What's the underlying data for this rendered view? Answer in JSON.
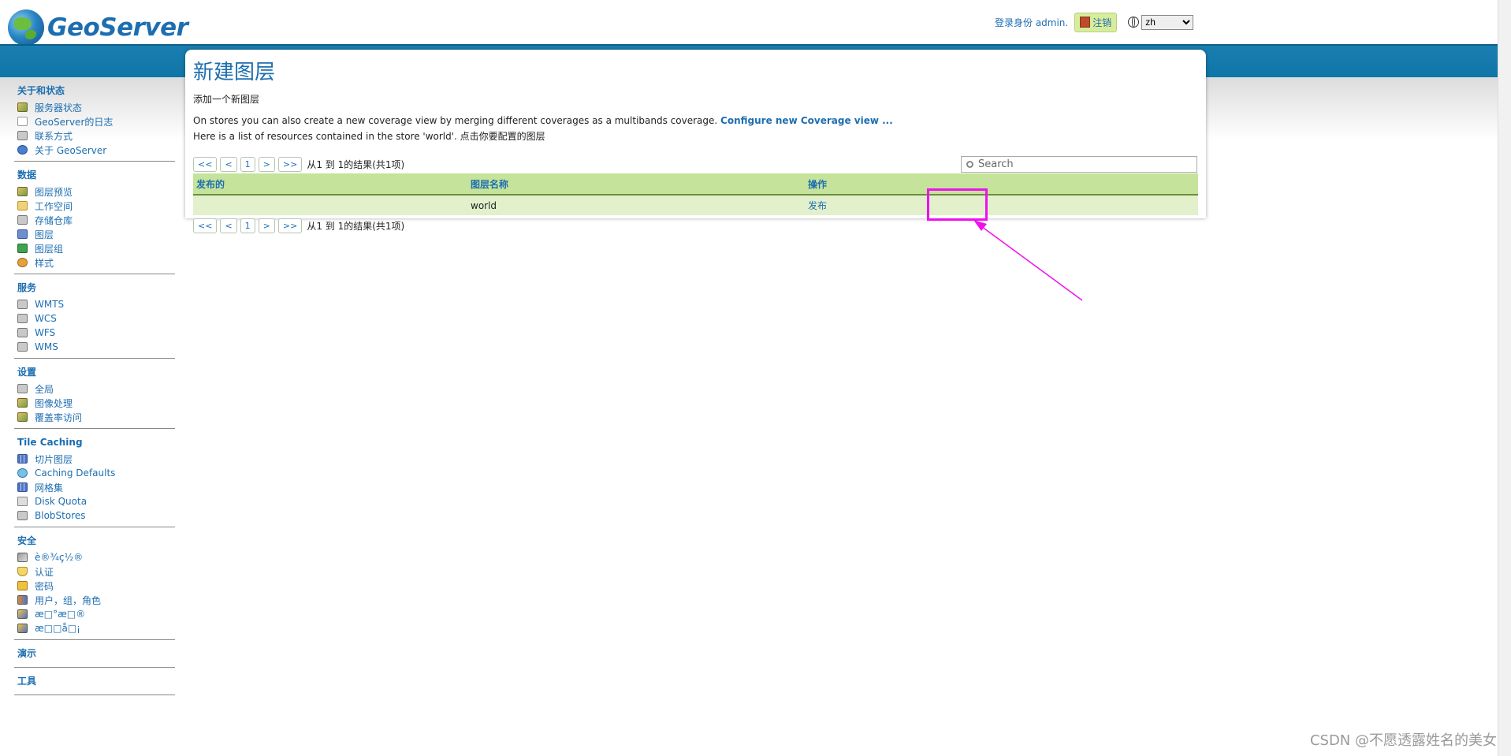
{
  "header": {
    "logo_text": "GeoServer",
    "login_status": "登录身份 admin.",
    "logout_label": "注销",
    "language_options": [
      "zh"
    ],
    "language_selected": "zh"
  },
  "sidebar": {
    "sections": [
      {
        "title": "关于和状态",
        "items": [
          {
            "label": "服务器状态",
            "icon": "server-status-icon"
          },
          {
            "label": "GeoServer的日志",
            "icon": "log-icon"
          },
          {
            "label": "联系方式",
            "icon": "contact-icon"
          },
          {
            "label": "关于 GeoServer",
            "icon": "info-icon"
          }
        ]
      },
      {
        "title": "数据",
        "items": [
          {
            "label": "图层预览",
            "icon": "layer-preview-icon"
          },
          {
            "label": "工作空间",
            "icon": "folder-icon"
          },
          {
            "label": "存储仓库",
            "icon": "store-icon"
          },
          {
            "label": "图层",
            "icon": "layer-icon"
          },
          {
            "label": "图层组",
            "icon": "layer-group-icon"
          },
          {
            "label": "样式",
            "icon": "style-palette-icon"
          }
        ]
      },
      {
        "title": "服务",
        "items": [
          {
            "label": "WMTS",
            "icon": "service-icon"
          },
          {
            "label": "WCS",
            "icon": "service-icon"
          },
          {
            "label": "WFS",
            "icon": "service-icon"
          },
          {
            "label": "WMS",
            "icon": "service-icon"
          }
        ]
      },
      {
        "title": "设置",
        "items": [
          {
            "label": "全局",
            "icon": "server-icon"
          },
          {
            "label": "图像处理",
            "icon": "image-icon"
          },
          {
            "label": "覆盖率访问",
            "icon": "image-icon"
          }
        ]
      },
      {
        "title": "Tile Caching",
        "items": [
          {
            "label": "切片图层",
            "icon": "grid-icon"
          },
          {
            "label": "Caching Defaults",
            "icon": "globe-icon"
          },
          {
            "label": "网格集",
            "icon": "grid-icon"
          },
          {
            "label": "Disk Quota",
            "icon": "disk-icon"
          },
          {
            "label": "BlobStores",
            "icon": "store-icon"
          }
        ]
      },
      {
        "title": "安全",
        "items": [
          {
            "label": "è®¾ç½®",
            "icon": "wrench-icon"
          },
          {
            "label": "认证",
            "icon": "shield-icon"
          },
          {
            "label": "密码",
            "icon": "lock-icon"
          },
          {
            "label": "用户，组，角色",
            "icon": "users-icon"
          },
          {
            "label": "æ□°æ□®",
            "icon": "data-security-icon"
          },
          {
            "label": "æ□□å□¡",
            "icon": "service-security-icon"
          }
        ]
      },
      {
        "title": "演示",
        "items": []
      },
      {
        "title": "工具",
        "items": []
      }
    ]
  },
  "main": {
    "title": "新建图层",
    "subtitle": "添加一个新图层",
    "description_1": "On stores you can also create a new coverage view by merging different coverages as a multibands coverage.",
    "coverage_link": "Configure new Coverage view ...",
    "description_2": "Here is a list of resources contained in the store 'world'. 点击你要配置的图层",
    "pager": {
      "first": "<<",
      "prev": "<",
      "page": "1",
      "next": ">",
      "last": ">>",
      "info": "从1 到 1的结果(共1项)"
    },
    "search_placeholder": "Search",
    "table": {
      "columns": [
        "发布的",
        "图层名称",
        "操作"
      ],
      "rows": [
        {
          "published": "",
          "name": "world",
          "action": "发布"
        }
      ]
    }
  },
  "watermark": "CSDN @不愿透露姓名的美女",
  "colors": {
    "brand_blue": "#1d6eb0",
    "band_blue": "#1a7fb0",
    "table_header_green": "#c5e39b",
    "table_row_green": "#e2f0cc",
    "annotation_magenta": "#ee11ee"
  }
}
